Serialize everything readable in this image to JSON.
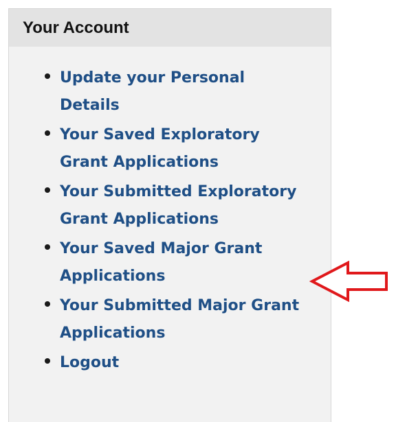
{
  "account_panel": {
    "title": "Your Account",
    "links": [
      {
        "label": "Update your Personal Details"
      },
      {
        "label": "Your Saved Exploratory Grant Applications"
      },
      {
        "label": "Your Submitted Exploratory Grant Applications"
      },
      {
        "label": "Your Saved Major Grant Applications"
      },
      {
        "label": "Your Submitted Major Grant Applications"
      },
      {
        "label": "Logout"
      }
    ]
  },
  "annotation": {
    "arrow_color": "#e0181b",
    "arrow_icon": "left-arrow-outline-icon"
  }
}
